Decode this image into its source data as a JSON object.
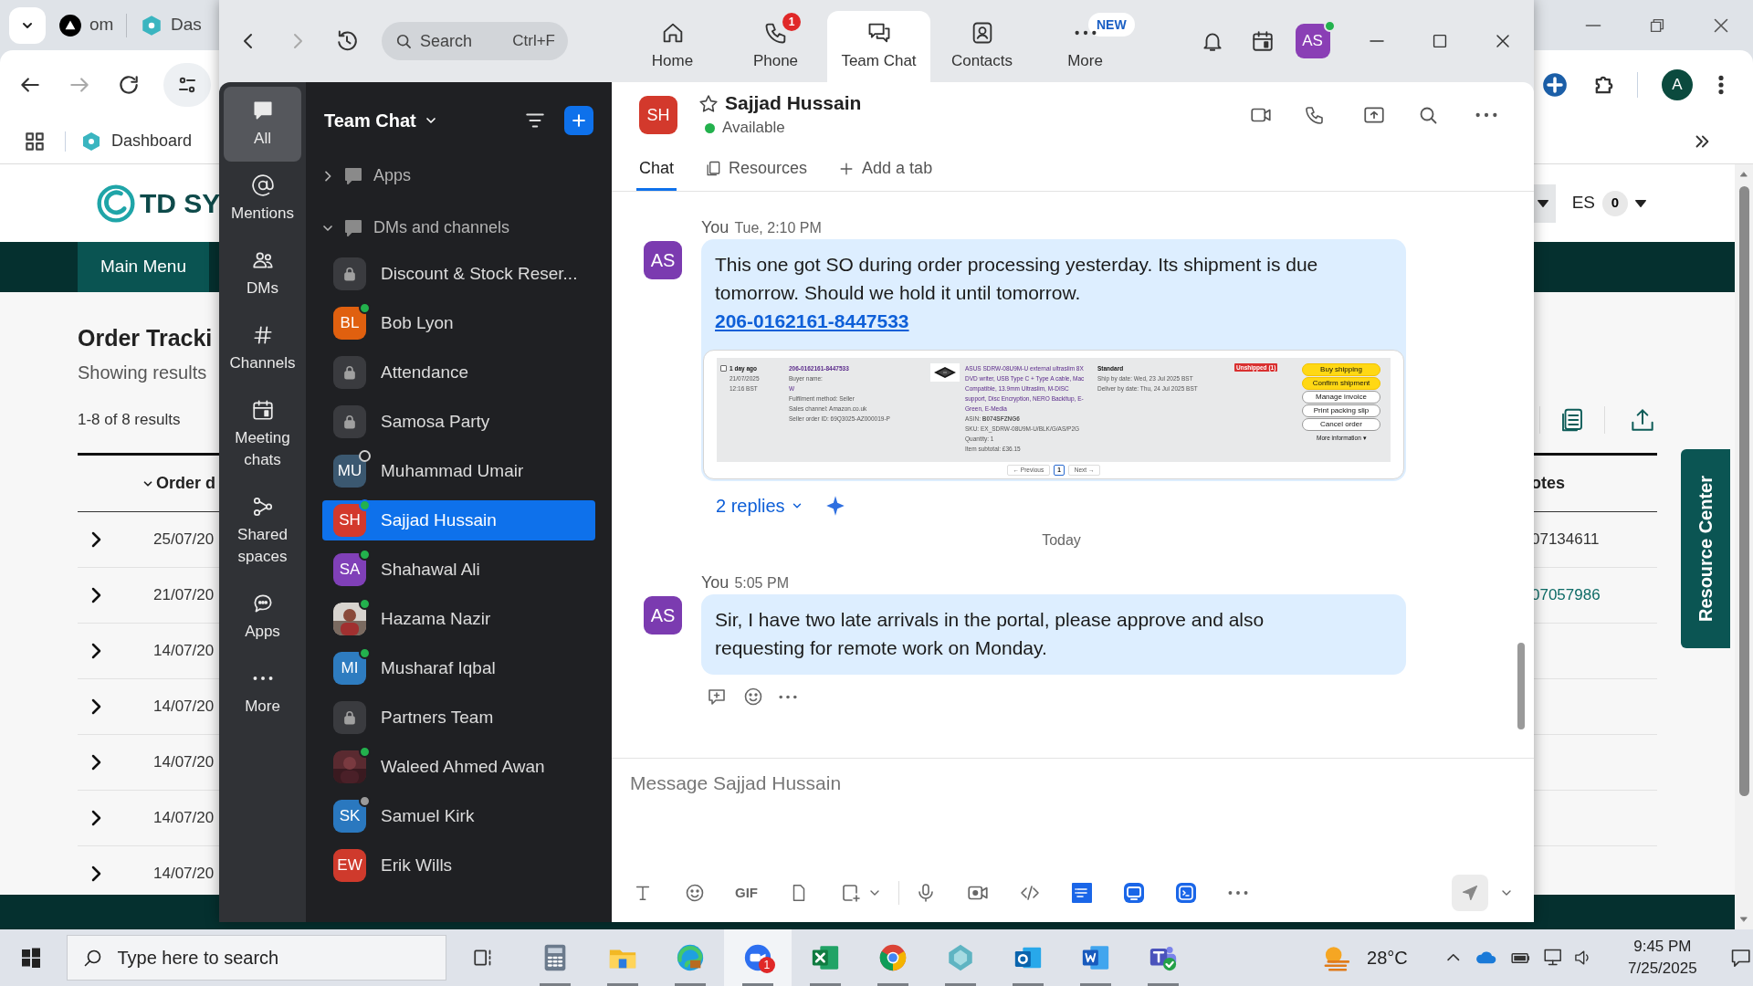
{
  "browser": {
    "tabs": [
      {
        "label": "om"
      },
      {
        "label": "Das"
      }
    ],
    "bookmarks": [
      {
        "label": "Dashboard"
      }
    ],
    "profile_initial": "A",
    "page": {
      "logo_text": "TD SY",
      "language": "ES",
      "count_badge": "0",
      "nav": [
        {
          "label": "Main Menu",
          "selected": true
        }
      ],
      "title": "Order Tracki",
      "subtitle": "Showing results",
      "result_count": "1-8 of 8 results",
      "table": {
        "columns": [
          "Order d",
          "otes"
        ],
        "rows": [
          {
            "date": "25/07/20",
            "notes": "07134611",
            "notes_link": false
          },
          {
            "date": "21/07/20",
            "notes": "07057986",
            "notes_link": true
          },
          {
            "date": "14/07/20"
          },
          {
            "date": "14/07/20"
          },
          {
            "date": "14/07/20"
          },
          {
            "date": "14/07/20"
          },
          {
            "date": "14/07/20"
          }
        ]
      },
      "resource_center": "Resource Center"
    }
  },
  "zoom": {
    "search": {
      "placeholder": "Search",
      "shortcut": "Ctrl+F"
    },
    "nav_tabs": [
      {
        "label": "Home",
        "selected": false
      },
      {
        "label": "Phone",
        "selected": false,
        "badge": {
          "text": "1",
          "kind": "count"
        }
      },
      {
        "label": "Team Chat",
        "selected": true
      },
      {
        "label": "Contacts",
        "selected": false
      },
      {
        "label": "More",
        "selected": false,
        "badge": {
          "text": "NEW",
          "kind": "new"
        }
      }
    ],
    "user": {
      "initials": "AS",
      "online": true
    },
    "rail": [
      {
        "label": "All",
        "selected": true
      },
      {
        "label": "Mentions",
        "selected": false
      },
      {
        "label": "DMs",
        "selected": false
      },
      {
        "label": "Channels",
        "selected": false
      },
      {
        "label": "Meeting chats",
        "selected": false
      },
      {
        "label": "Shared spaces",
        "selected": false
      },
      {
        "label": "Apps",
        "selected": false
      },
      {
        "label": "More",
        "selected": false
      }
    ],
    "list": {
      "title": "Team Chat",
      "sections": [
        {
          "label": "Apps",
          "expanded": false
        },
        {
          "label": "DMs and channels",
          "expanded": true,
          "children": [
            {
              "kind": "channel",
              "name": "Discount & Stock Reser...",
              "selected": false
            },
            {
              "kind": "avatar",
              "name": "Bob Lyon",
              "initials": "BL",
              "color": "#e0600f",
              "online": true,
              "selected": false
            },
            {
              "kind": "channel",
              "name": "Attendance",
              "selected": false
            },
            {
              "kind": "channel",
              "name": "Samosa Party",
              "selected": false
            },
            {
              "kind": "avatar",
              "name": "Muhammad Umair",
              "initials": "MU",
              "color": "#3b5870",
              "online": false,
              "selected": false
            },
            {
              "kind": "avatar",
              "name": "Sajjad Hussain",
              "initials": "SH",
              "color": "#d3392c",
              "online": true,
              "selected": true
            },
            {
              "kind": "avatar",
              "name": "Shahawal Ali",
              "initials": "SA",
              "color": "#8040b8",
              "online": true,
              "selected": false
            },
            {
              "name": "Hazama Nazir",
              "online": true,
              "selected": false
            },
            {
              "kind": "avatar",
              "name": "Musharaf Iqbal",
              "initials": "MI",
              "color": "#2e7cc0",
              "online": true,
              "selected": false
            },
            {
              "kind": "channel",
              "name": "Partners Team",
              "selected": false
            },
            {
              "name": "Waleed Ahmed Awan",
              "online": true,
              "selected": false
            },
            {
              "kind": "avatar",
              "name": "Samuel Kirk",
              "initials": "SK",
              "color": "#2a78bf",
              "online": false,
              "away": true,
              "selected": false
            },
            {
              "kind": "avatar",
              "name": "Erik Wills",
              "initials": "EW",
              "color": "#cf3a2c",
              "selected": false
            }
          ]
        }
      ]
    },
    "chat": {
      "contact": {
        "initials": "SH",
        "name": "Sajjad Hussain",
        "status": "Available",
        "starred": false
      },
      "tabs": [
        {
          "label": "Chat",
          "selected": true
        },
        {
          "label": "Resources",
          "selected": false
        },
        {
          "label": "Add a tab",
          "selected": false
        }
      ],
      "messages": [
        {
          "kind": "message",
          "sender": "You",
          "time": "Tue, 2:10 PM",
          "initials": "AS",
          "text": "This one got SO during order processing yesterday. Its shipment is due tomorrow. Should we hold it until tomorrow.",
          "link": "206-0162161-8447533",
          "attachment": {
            "kind": "screenshot",
            "checked": false,
            "age": "1 day ago",
            "date": "21/07/2025",
            "time": "12:16 BST",
            "order_id": "206-0162161-8447533",
            "buyer_label": "Buyer name:",
            "buyer": "W",
            "fulfilment": "Fulfilment method: Seller",
            "sales_channel": "Sales channel: Amazon.co.uk",
            "seller_order": "Seller order ID: 69Q3025-AZ000019-P",
            "product": "ASUS SDRW-08U9M-U external ultraslim 8X DVD writer, USB Type C + Type A cable, Mac Compatible, 13.9mm Ultraslim, M-DISC support, Disc Encryption, NERO Backitup, E-Green, E-Media",
            "asin": "ASIN: **B074SFZNG6**",
            "sku": "SKU: EX_SDRW-08U9M-U/BLK/G/AS/P2G",
            "quantity": "Quantity: 1",
            "subtotal": "Item subtotal: £36.15",
            "shipping": "Standard",
            "ship_by": "Ship by date: Wed, 23 Jul 2025 BST",
            "deliver_by": "Deliver by date: Thu, 24 Jul 2025 BST",
            "order_status": "Unshipped (1)",
            "actions": [
              {
                "label": "Buy shipping",
                "kind": "primary"
              },
              {
                "label": "Confirm shipment",
                "kind": "primary"
              },
              {
                "label": "Manage invoice",
                "kind": "secondary"
              },
              {
                "label": "Print packing slip",
                "kind": "secondary"
              },
              {
                "label": "Cancel order",
                "kind": "secondary"
              }
            ],
            "more": "More information ▾",
            "pagination": {
              "previous": "← Previous",
              "page": "1",
              "next": "Next →"
            }
          },
          "replies": "2 replies"
        },
        {
          "kind": "divider",
          "label": "Today"
        },
        {
          "kind": "message",
          "sender": "You",
          "time": "5:05 PM",
          "initials": "AS",
          "text": "Sir, I have two late arrivals in the portal, please approve and also requesting for remote work on Monday."
        }
      ],
      "composer": {
        "placeholder": "Message Sajjad Hussain",
        "gif_label": "GIF"
      }
    }
  },
  "taskbar": {
    "search_placeholder": "Type here to search",
    "apps": [
      {
        "active": false
      },
      {
        "active": false
      },
      {
        "active": false
      },
      {
        "active": true,
        "badge": "1"
      },
      {
        "active": false
      },
      {
        "active": false
      },
      {
        "active": false
      },
      {
        "active": false
      },
      {
        "active": false
      },
      {
        "active": false
      }
    ],
    "weather": "28°C",
    "time": "9:45 PM",
    "date": "7/25/2025"
  }
}
